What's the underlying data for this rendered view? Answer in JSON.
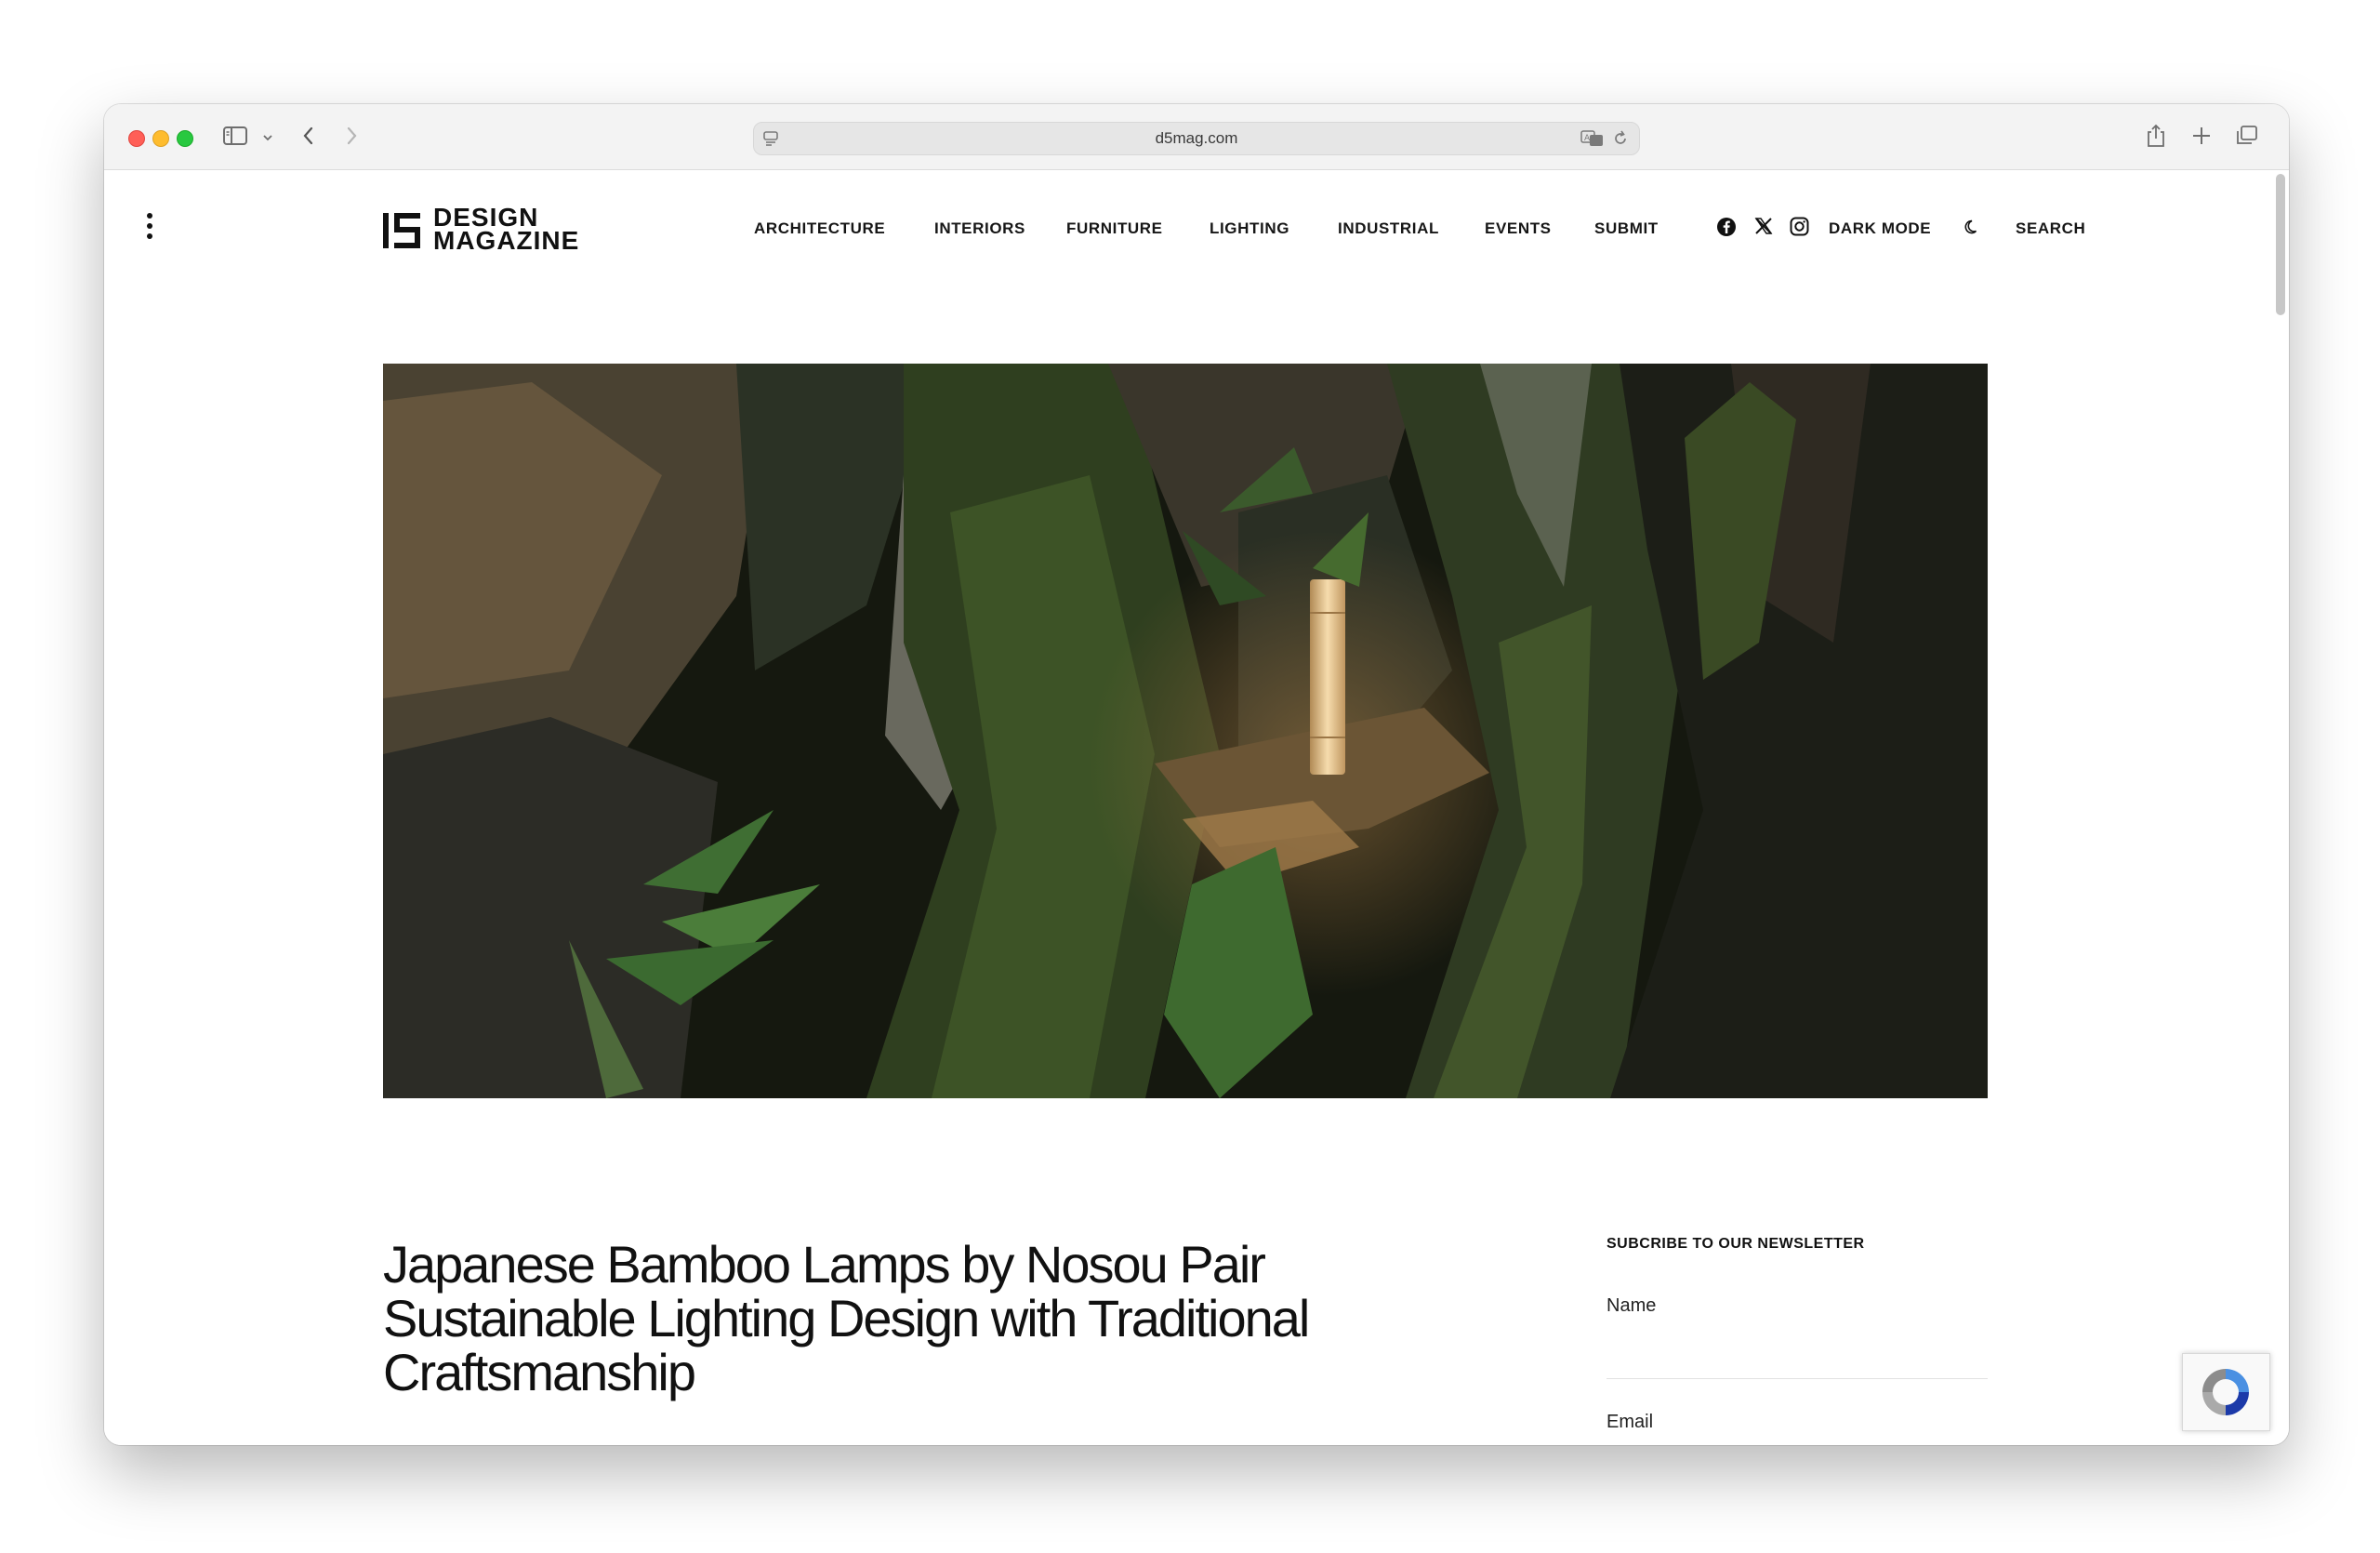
{
  "browser": {
    "url": "d5mag.com"
  },
  "site": {
    "logo_line1": "DESIGN",
    "logo_line2": "MAGAZINE",
    "nav": [
      "ARCHITECTURE",
      "INTERIORS",
      "FURNITURE",
      "LIGHTING",
      "INDUSTRIAL",
      "EVENTS",
      "SUBMIT"
    ],
    "dark_mode_label": "DARK MODE",
    "search_label": "SEARCH",
    "social_icons": [
      "facebook-icon",
      "x-icon",
      "instagram-icon"
    ]
  },
  "article": {
    "title_line1": "Japanese Bamboo Lamps by Nosou Pair",
    "title_line2": "Sustainable Lighting Design with Traditional",
    "title_line3": "Craftsmanship"
  },
  "newsletter": {
    "heading": "SUBCRIBE TO OUR NEWSLETTER",
    "name_label": "Name",
    "email_label": "Email"
  }
}
